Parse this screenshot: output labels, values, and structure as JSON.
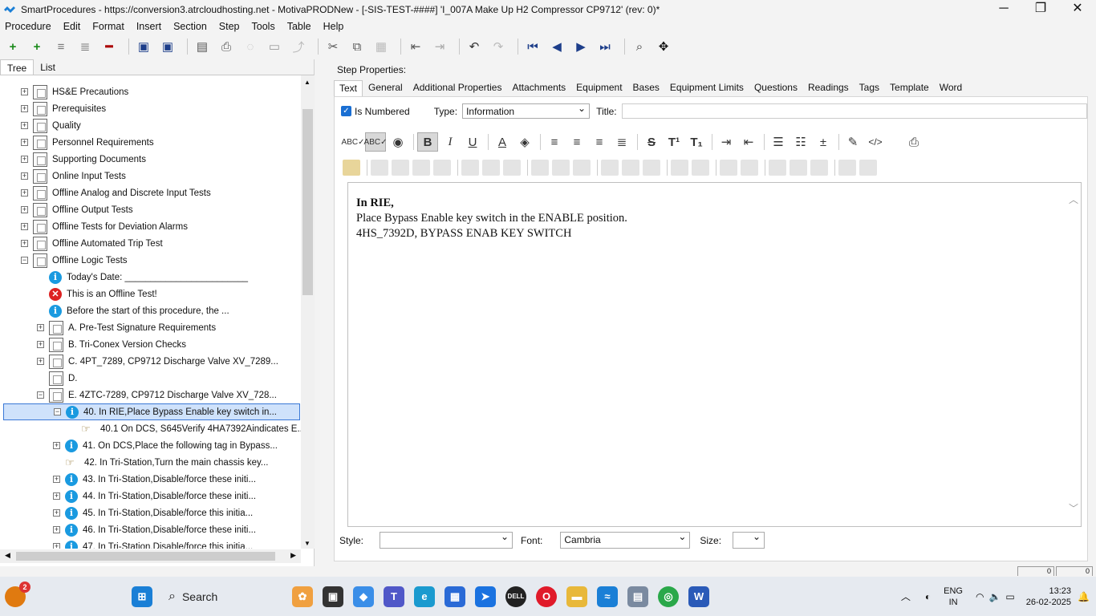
{
  "window": {
    "title": "SmartProcedures - https://conversion3.atrcloudhosting.net - MotivaPRODNew - [-SIS-TEST-####] 'I_007A Make Up H2 Compressor CP9712' (rev: 0)*"
  },
  "menu": [
    "Procedure",
    "Edit",
    "Format",
    "Insert",
    "Section",
    "Step",
    "Tools",
    "Table",
    "Help"
  ],
  "left_tabs": [
    "Tree",
    "List"
  ],
  "tree": [
    {
      "level": 1,
      "icon": "doc",
      "expand": "+",
      "label": "HS&E Precautions"
    },
    {
      "level": 1,
      "icon": "doc",
      "expand": "+",
      "label": "Prerequisites"
    },
    {
      "level": 1,
      "icon": "doc",
      "expand": "+",
      "label": "Quality"
    },
    {
      "level": 1,
      "icon": "doc",
      "expand": "+",
      "label": "Personnel Requirements"
    },
    {
      "level": 1,
      "icon": "doc",
      "expand": "+",
      "label": "Supporting Documents"
    },
    {
      "level": 1,
      "icon": "doc",
      "expand": "+",
      "label": "Online Input Tests"
    },
    {
      "level": 1,
      "icon": "doc",
      "expand": "+",
      "label": "Offline Analog and Discrete Input Tests"
    },
    {
      "level": 1,
      "icon": "doc",
      "expand": "+",
      "label": "Offline Output Tests"
    },
    {
      "level": 1,
      "icon": "doc",
      "expand": "+",
      "label": "Offline Tests for Deviation Alarms"
    },
    {
      "level": 1,
      "icon": "doc",
      "expand": "+",
      "label": "Offline Automated Trip Test"
    },
    {
      "level": 1,
      "icon": "doc",
      "expand": "-",
      "label": "Offline Logic Tests"
    },
    {
      "level": 2,
      "icon": "info",
      "expand": "",
      "label": "Today's Date: ________________________"
    },
    {
      "level": 2,
      "icon": "error",
      "expand": "",
      "label": "This is an Offline Test!"
    },
    {
      "level": 2,
      "icon": "info",
      "expand": "",
      "label": "Before the start of this procedure, the ..."
    },
    {
      "level": 2,
      "icon": "doc",
      "expand": "+",
      "label": "A. Pre-Test Signature Requirements"
    },
    {
      "level": 2,
      "icon": "doc",
      "expand": "+",
      "label": "B. Tri-Conex Version Checks"
    },
    {
      "level": 2,
      "icon": "doc",
      "expand": "+",
      "label": "C. 4PT_7289, CP9712 Discharge Valve XV_7289..."
    },
    {
      "level": 2,
      "icon": "doc",
      "expand": "",
      "label": "D."
    },
    {
      "level": 2,
      "icon": "doc",
      "expand": "-",
      "label": "E. 4ZTC-7289, CP9712 Discharge Valve XV_728..."
    },
    {
      "level": 3,
      "icon": "info",
      "expand": "-",
      "label": "40. In RIE,Place Bypass Enable key switch in...",
      "selected": true
    },
    {
      "level": 4,
      "icon": "hand",
      "expand": "",
      "label": "40.1 On DCS, S645Verify 4HA7392Aindicates E..."
    },
    {
      "level": 3,
      "icon": "info",
      "expand": "+",
      "label": "41. On DCS,Place the following tag in Bypass..."
    },
    {
      "level": 3,
      "icon": "hand",
      "expand": "",
      "label": "42. In Tri-Station,Turn the main chassis key..."
    },
    {
      "level": 3,
      "icon": "info",
      "expand": "+",
      "label": "43. In Tri-Station,Disable/force these initi..."
    },
    {
      "level": 3,
      "icon": "info",
      "expand": "+",
      "label": "44. In Tri-Station,Disable/force these initi..."
    },
    {
      "level": 3,
      "icon": "info",
      "expand": "+",
      "label": "45. In Tri-Station,Disable/force this initia..."
    },
    {
      "level": 3,
      "icon": "info",
      "expand": "+",
      "label": "46. In Tri-Station,Disable/force these initi..."
    },
    {
      "level": 3,
      "icon": "info",
      "expand": "+",
      "label": "47. In Tri-Station,Disable/force this initia..."
    }
  ],
  "step_properties": {
    "label": "Step Properties:",
    "tabs": [
      "Text",
      "General",
      "Additional Properties",
      "Attachments",
      "Equipment",
      "Bases",
      "Equipment Limits",
      "Questions",
      "Readings",
      "Tags",
      "Template",
      "Word"
    ],
    "is_numbered_label": "Is Numbered",
    "type_label": "Type:",
    "type_value": "Information",
    "title_label": "Title:",
    "title_value": ""
  },
  "editor": {
    "line1": "In RIE,",
    "line2": "Place Bypass Enable key switch in the ENABLE position.",
    "line3": "4HS_7392D, BYPASS ENAB KEY SWITCH"
  },
  "bottom": {
    "style_label": "Style:",
    "style_value": "",
    "font_label": "Font:",
    "font_value": "Cambria",
    "size_label": "Size:",
    "size_value": ""
  },
  "status": {
    "cell1": "0",
    "cell2": "0"
  },
  "taskbar": {
    "search_label": "Search",
    "badge": "2",
    "lang": "ENG",
    "region": "IN",
    "time": "13:23",
    "date": "26-02-2025"
  }
}
